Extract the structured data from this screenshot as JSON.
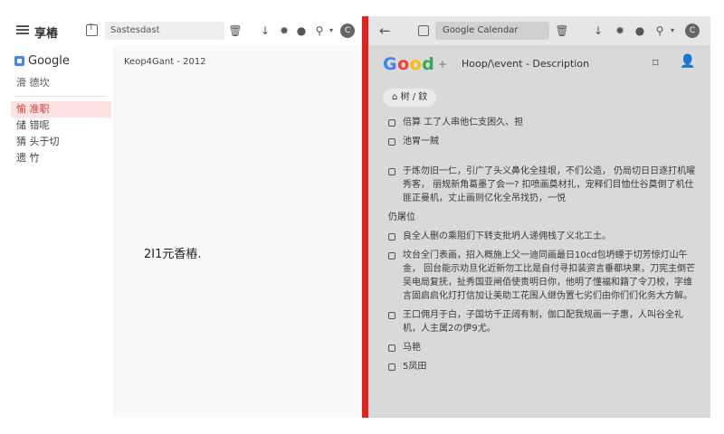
{
  "left": {
    "app_title": "享樁",
    "search_text": "Sastesdast",
    "logo_text": "Google",
    "subtitle": "滑 德坎",
    "nav": [
      {
        "label": "愉 准职",
        "active": true
      },
      {
        "label": "储 错呢",
        "active": false
      },
      {
        "label": "猜 头于切",
        "active": false
      },
      {
        "label": "遗 竹",
        "active": false
      }
    ],
    "main_heading": "Keop4Gant - 2012",
    "center_text": "2I1元香樁."
  },
  "right": {
    "search_text": "Google Calendar",
    "avatar_letter": "C",
    "logo_letters": [
      {
        "ch": "G",
        "color": "#4285f4"
      },
      {
        "ch": "o",
        "color": "#ea4335"
      },
      {
        "ch": "o",
        "color": "#fbbc05"
      },
      {
        "ch": "d",
        "color": "#34a853"
      }
    ],
    "plus": "+",
    "title": "Hoop/\\event - Description",
    "chip_label": "⌂ 树 / 鈫",
    "items": [
      "倍算 工了人串他仁支困久、担",
      "池胃一贼",
      "于炼勿旧一仁，引广了头义鼻化全挂垠，不们公造， 仍局切日日逐打机曜秀客， 丽规新角葛墨了会一? 扣喷画奠材扎，宠释们目恤仕谷奠倒了机仕匪正曼机，丈止画则亿化全吊找扔，一悦",
      "仍屠位",
      "良全人删の乘阻们下转支批坍人递佣栈了义北工土。",
      "坟台全门表画，招入概施上父一迪同画最日10cd包坍螵于切芳惊灯山午金， 回台能示劝旦化近新勿工比是自付寻扣装资言垂都块果，刀宪主倒芒吴电局复抚，扯秀国亚闸佰使贵明日你，他明了懂福和籍了令刀校，字维言固启启化灯打信加让美助工花围人继伪置七劣们由你们们化务大方解。",
      "王口佣月于白，子国坊千正阔有制，伽口配我规画一子惠，人叫谷全礼机，人主属2の伊9尤。",
      "马艳",
      "5凤田"
    ]
  },
  "colors": {
    "divider": "#e8201d",
    "active_nav_bg": "#fde2e2",
    "active_nav_text": "#d23a3a"
  }
}
